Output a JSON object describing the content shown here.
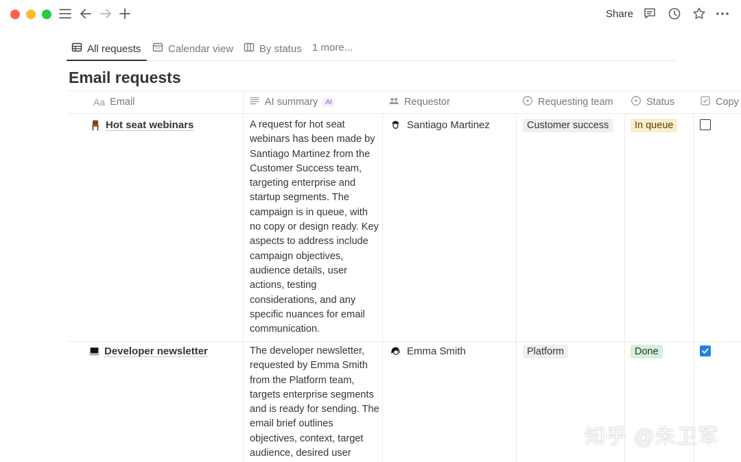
{
  "toolbar": {
    "share_label": "Share",
    "icons": [
      "menu-icon",
      "back-arrow-icon",
      "forward-arrow-icon",
      "plus-icon",
      "comment-icon",
      "history-icon",
      "star-icon",
      "more-icon"
    ]
  },
  "views": {
    "tabs": [
      {
        "label": "All requests",
        "icon": "table-icon",
        "active": true
      },
      {
        "label": "Calendar view",
        "icon": "calendar-icon",
        "active": false
      },
      {
        "label": "By status",
        "icon": "board-icon",
        "active": false
      },
      {
        "label": "1 more...",
        "icon": "",
        "active": false
      }
    ]
  },
  "page": {
    "title": "Email requests"
  },
  "table": {
    "columns": [
      {
        "label": "Email",
        "icon": "text-aa-icon"
      },
      {
        "label": "AI summary",
        "icon": "lines-icon",
        "badge": "AI"
      },
      {
        "label": "Requestor",
        "icon": "people-icon"
      },
      {
        "label": "Requesting team",
        "icon": "select-icon"
      },
      {
        "label": "Status",
        "icon": "status-icon"
      },
      {
        "label": "Copy",
        "icon": "checkbox-icon"
      }
    ],
    "rows": [
      {
        "email": "Hot seat webinars",
        "emoji": "chair-icon",
        "summary": "A request for hot seat webinars has been made by Santiago Martinez from the Customer Success team, targeting enterprise and startup segments. The campaign is in queue, with no copy or design ready. Key aspects to address include campaign objectives, audience details, user actions, testing considerations, and any specific nuances for email communication.",
        "requestor": "Santiago Martinez",
        "team": "Customer success",
        "status": "In queue",
        "status_color": "#fbeecb",
        "copy_checked": false
      },
      {
        "email": "Developer newsletter",
        "emoji": "laptop-icon",
        "summary": "The developer newsletter, requested by Emma Smith from the Platform team, targets enterprise segments and is ready for sending. The email brief outlines objectives, context, target audience, desired user",
        "requestor": "Emma Smith",
        "team": "Platform",
        "status": "Done",
        "status_color": "#dbeddb",
        "copy_checked": true
      }
    ]
  },
  "watermark": "知乎 @朱卫军",
  "colors": {
    "accent": "#2383e2",
    "text": "#37352f",
    "muted": "#787774"
  }
}
